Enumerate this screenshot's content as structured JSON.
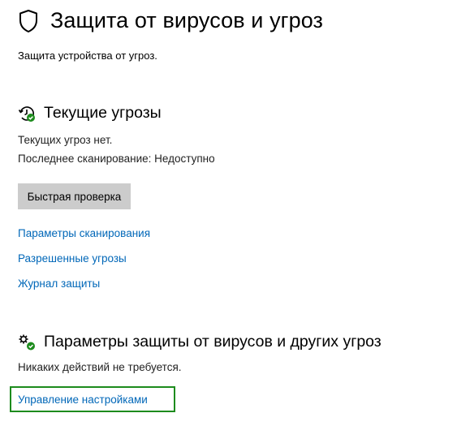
{
  "header": {
    "title": "Защита от вирусов и угроз",
    "subtitle": "Защита устройства от угроз.",
    "icon": "shield-icon"
  },
  "current_threats": {
    "title": "Текущие угрозы",
    "icon": "history-check-icon",
    "status": "Текущих угроз нет.",
    "last_scan": "Последнее сканирование: Недоступно",
    "quick_scan_label": "Быстрая проверка",
    "links": [
      "Параметры сканирования",
      "Разрешенные угрозы",
      "Журнал защиты"
    ]
  },
  "protection_settings": {
    "title": "Параметры защиты от вирусов и других угроз",
    "icon": "gears-check-icon",
    "status": "Никаких действий не требуется.",
    "manage_label": "Управление настройками"
  },
  "colors": {
    "link": "#0067b8",
    "button_bg": "#cccccc",
    "ok_badge": "#1d8b1d",
    "highlight_border": "#1d8b1d"
  }
}
